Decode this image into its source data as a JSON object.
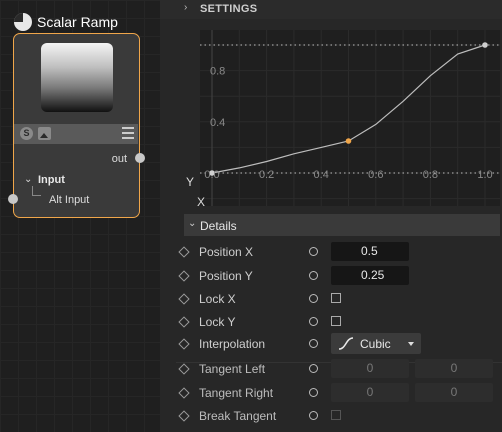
{
  "node": {
    "title": "Scalar Ramp",
    "out_label": "out",
    "input_section_label": "Input",
    "alt_input_label": "Alt Input",
    "s_badge": "S"
  },
  "settings": {
    "label": "SETTINGS"
  },
  "chart_data": {
    "type": "line",
    "x_ticks": [
      "0.0",
      "0.2",
      "0.4",
      "0.6",
      "0.8",
      "1.0"
    ],
    "y_ticks": [
      "0.4",
      "0.8"
    ],
    "xlabel": "X",
    "ylabel": "Y",
    "xlim": [
      0,
      1
    ],
    "ylim": [
      0,
      1
    ],
    "curve_x": [
      0,
      0.1,
      0.2,
      0.3,
      0.4,
      0.5,
      0.6,
      0.7,
      0.8,
      0.9,
      1.0
    ],
    "curve_y": [
      0,
      0.04,
      0.09,
      0.15,
      0.2,
      0.25,
      0.38,
      0.56,
      0.76,
      0.93,
      1.0
    ],
    "points": [
      {
        "x": 0,
        "y": 0,
        "color": "#cfcfcf"
      },
      {
        "x": 0.5,
        "y": 0.25,
        "color": "#f0a64a"
      },
      {
        "x": 1,
        "y": 1,
        "color": "#cfcfcf"
      }
    ],
    "guide_lines_y": [
      0,
      1
    ]
  },
  "details": {
    "label": "Details",
    "position_x": {
      "label": "Position X",
      "value": "0.5"
    },
    "position_y": {
      "label": "Position Y",
      "value": "0.25"
    },
    "lock_x": {
      "label": "Lock X"
    },
    "lock_y": {
      "label": "Lock Y"
    },
    "interpolation": {
      "label": "Interpolation",
      "value": "Cubic"
    },
    "tangent_left": {
      "label": "Tangent Left",
      "values": [
        "0",
        "0"
      ]
    },
    "tangent_right": {
      "label": "Tangent Right",
      "values": [
        "0",
        "0"
      ]
    },
    "break_tangent": {
      "label": "Break Tangent"
    }
  },
  "colors": {
    "accent": "#f0a64a",
    "panel_bg": "#272727"
  }
}
